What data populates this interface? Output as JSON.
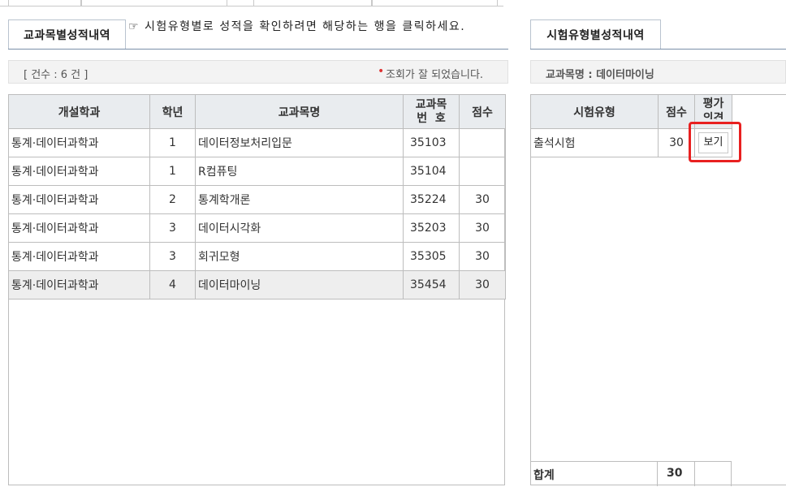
{
  "left_tab": {
    "label": "교과목별성적내역"
  },
  "notice": {
    "text": "☞ 시험유형별로 성적을 확인하려면 해당하는 행을 클릭하세요."
  },
  "left_info": {
    "count_text": "[ 건수 : 6 건 ]",
    "status_bullet": "•",
    "status_text": "조회가 잘 되었습니다."
  },
  "courses_table": {
    "headers": {
      "dept": "개설학과",
      "year": "학년",
      "name": "교과목명",
      "code_line1": "교과목",
      "code_line2": "번  호",
      "score": "점수"
    },
    "rows": [
      {
        "dept": "통계·데이터과학과",
        "year": "1",
        "name": "데이터정보처리입문",
        "code": "35103",
        "score": ""
      },
      {
        "dept": "통계·데이터과학과",
        "year": "1",
        "name": "R컴퓨팅",
        "code": "35104",
        "score": ""
      },
      {
        "dept": "통계·데이터과학과",
        "year": "2",
        "name": "통계학개론",
        "code": "35224",
        "score": "30"
      },
      {
        "dept": "통계·데이터과학과",
        "year": "3",
        "name": "데이터시각화",
        "code": "35203",
        "score": "30"
      },
      {
        "dept": "통계·데이터과학과",
        "year": "3",
        "name": "회귀모형",
        "code": "35305",
        "score": "30"
      },
      {
        "dept": "통계·데이터과학과",
        "year": "4",
        "name": "데이터마이닝",
        "code": "35454",
        "score": "30"
      }
    ]
  },
  "right_tab": {
    "label": "시험유형별성적내역"
  },
  "right_info": {
    "course_label": "교과목명 : 데이터마이닝"
  },
  "exam_table": {
    "headers": {
      "type": "시험유형",
      "score": "점수",
      "eval_line1": "평가",
      "eval_line2": "의견"
    },
    "rows": [
      {
        "type": "출석시험",
        "score": "30",
        "button": "보기"
      }
    ],
    "total_label": "합계",
    "total_score": "30"
  },
  "colors": {
    "highlight": "#e82020",
    "header_bg": "#e9ecef",
    "selected_row_bg": "#eeeeee"
  }
}
